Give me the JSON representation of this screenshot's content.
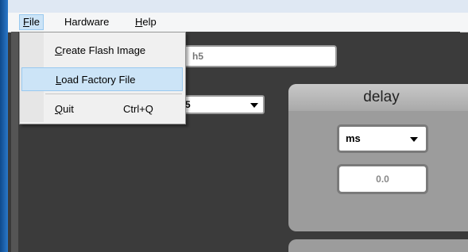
{
  "menubar": {
    "items": [
      {
        "mnemonic": "F",
        "rest": "ile"
      },
      {
        "mnemonic": "",
        "rest": "Hardware"
      },
      {
        "mnemonic": "H",
        "rest": "elp"
      }
    ]
  },
  "file_menu": {
    "items": [
      {
        "mnemonic": "C",
        "rest": "reate Flash Image",
        "shortcut": ""
      },
      {
        "mnemonic": "L",
        "rest": "oad Factory File",
        "shortcut": ""
      },
      {
        "mnemonic": "Q",
        "rest": "uit",
        "shortcut": "Ctrl+Q"
      }
    ]
  },
  "main": {
    "name_field_value": "h5",
    "left_combo_value": "5"
  },
  "delay_panel": {
    "title": "delay",
    "unit_value": "ms",
    "value": "0.0"
  }
}
